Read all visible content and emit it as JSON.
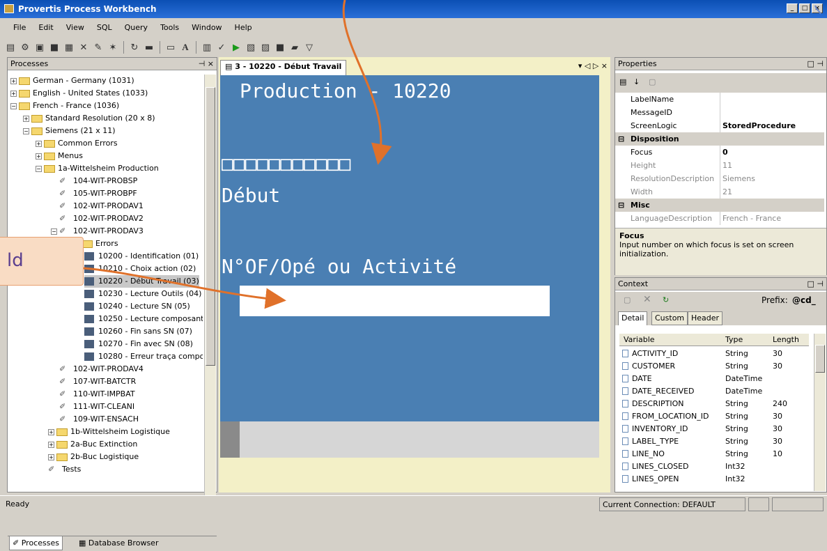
{
  "app": {
    "title": "Provertis Process Workbench"
  },
  "menu": [
    "File",
    "Edit",
    "View",
    "SQL",
    "Query",
    "Tools",
    "Window",
    "Help"
  ],
  "processes_panel": {
    "title": "Processes",
    "tree": [
      {
        "label": "German - Germany (1031)"
      },
      {
        "label": "English - United States (1033)"
      },
      {
        "label": "French - France (1036)"
      },
      {
        "label": "Standard Resolution (20 x 8)"
      },
      {
        "label": "Siemens (21 x 11)"
      },
      {
        "label": "Common Errors"
      },
      {
        "label": "Menus"
      },
      {
        "label": "1a-Wittelsheim Production"
      },
      {
        "label": "104-WIT-PROBSP"
      },
      {
        "label": "105-WIT-PROBPF"
      },
      {
        "label": "102-WIT-PRODAV1"
      },
      {
        "label": "102-WIT-PRODAV2"
      },
      {
        "label": "102-WIT-PRODAV3"
      },
      {
        "label": "Errors"
      },
      {
        "label": "10200 - Identification (01)"
      },
      {
        "label": "10210 - Choix action (02)"
      },
      {
        "label": "10220 - Début Travail (03)"
      },
      {
        "label": "10230 - Lecture Outils (04)"
      },
      {
        "label": "10240 - Lecture SN (05)"
      },
      {
        "label": "10250 - Lecture composant"
      },
      {
        "label": "10260 - Fin sans SN (07)"
      },
      {
        "label": "10270 - Fin avec SN (08)"
      },
      {
        "label": "10280 - Erreur traça compo"
      },
      {
        "label": "102-WIT-PRODAV4"
      },
      {
        "label": "107-WIT-BATCTR"
      },
      {
        "label": "110-WIT-IMPBAT"
      },
      {
        "label": "111-WIT-CLEANI"
      },
      {
        "label": "109-WIT-ENSACH"
      },
      {
        "label": "1b-Wittelsheim Logistique"
      },
      {
        "label": "2a-Buc Extinction"
      },
      {
        "label": "2b-Buc Logistique"
      },
      {
        "label": "Tests"
      }
    ],
    "tabs": [
      "Processes",
      "Database Browser"
    ]
  },
  "editor": {
    "tab_label": "3 - 10220 - Début Travail",
    "line_title": "Production - 10220",
    "line_boxes": "□□□□□□□□□□□",
    "line_debut": "Début",
    "line_prompt": "N°OF/Opé ou Activité"
  },
  "properties": {
    "title": "Properties",
    "rows": [
      {
        "k": "LabelName",
        "v": "",
        "type": "row"
      },
      {
        "k": "MessageID",
        "v": "",
        "type": "row"
      },
      {
        "k": "ScreenLogic",
        "v": "StoredProcedure",
        "type": "row",
        "bold": true
      },
      {
        "k": "Disposition",
        "v": "",
        "type": "cat"
      },
      {
        "k": "Focus",
        "v": "0",
        "type": "row",
        "bold": true
      },
      {
        "k": "Height",
        "v": "11",
        "type": "row",
        "grey": true
      },
      {
        "k": "ResolutionDescription",
        "v": "Siemens",
        "type": "row",
        "grey": true
      },
      {
        "k": "Width",
        "v": "21",
        "type": "row",
        "grey": true
      },
      {
        "k": "Misc",
        "v": "",
        "type": "cat"
      },
      {
        "k": "LanguageDescription",
        "v": "French - France",
        "type": "row",
        "grey": true
      }
    ],
    "desc_title": "Focus",
    "desc_text": "Input number on which focus is set on screen initialization."
  },
  "context": {
    "title": "Context",
    "prefix_label": "Prefix:",
    "prefix_value": "@cd_",
    "tabs": [
      "Detail",
      "Custom",
      "Header"
    ],
    "columns": [
      "Variable",
      "Type",
      "Length"
    ],
    "rows": [
      [
        "ACTIVITY_ID",
        "String",
        "30"
      ],
      [
        "CUSTOMER",
        "String",
        "30"
      ],
      [
        "DATE",
        "DateTime",
        ""
      ],
      [
        "DATE_RECEIVED",
        "DateTime",
        ""
      ],
      [
        "DESCRIPTION",
        "String",
        "240"
      ],
      [
        "FROM_LOCATION_ID",
        "String",
        "30"
      ],
      [
        "INVENTORY_ID",
        "String",
        "30"
      ],
      [
        "LABEL_TYPE",
        "String",
        "30"
      ],
      [
        "LINE_NO",
        "String",
        "10"
      ],
      [
        "LINES_CLOSED",
        "Int32",
        ""
      ],
      [
        "LINES_OPEN",
        "Int32",
        ""
      ]
    ]
  },
  "status": {
    "left": "Ready",
    "connection": "Current Connection: DEFAULT"
  },
  "annotation": {
    "text": "ld"
  }
}
